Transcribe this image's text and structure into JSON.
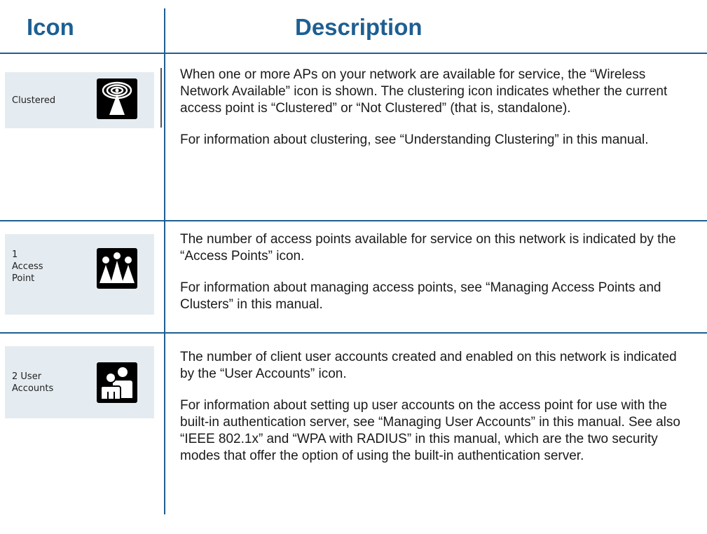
{
  "headers": {
    "icon": "Icon",
    "description": "Description"
  },
  "rows": [
    {
      "icon_label": "Clustered",
      "icon_name": "wireless-cluster-icon",
      "paragraphs": [
        "When one or more APs on your network are available for service, the “Wireless Network Available” icon is shown. The clustering icon indicates whether the current access point is “Clustered” or “Not Clustered” (that is, standalone).",
        "For information about clustering, see “Understanding Clustering” in this manual."
      ]
    },
    {
      "icon_label": "1\nAccess\nPoint",
      "icon_name": "access-points-icon",
      "paragraphs": [
        "The number of access points available for service on this network is indicated by the “Access Points” icon.",
        "For information about managing access points, see “Managing Access Points and Clusters” in this manual."
      ]
    },
    {
      "icon_label": "2 User\nAccounts",
      "icon_name": "user-accounts-icon",
      "paragraphs": [
        "The number of client user accounts created and enabled on this network is indicated by the “User Accounts” icon.",
        "For information about setting up user accounts on the access point for use with the built-in authentication server, see “Managing User Accounts” in this manual. See also “IEEE 802.1x” and “WPA with RADIUS” in this manual, which are the two security modes that offer the option of using the built-in authentication server."
      ]
    }
  ]
}
